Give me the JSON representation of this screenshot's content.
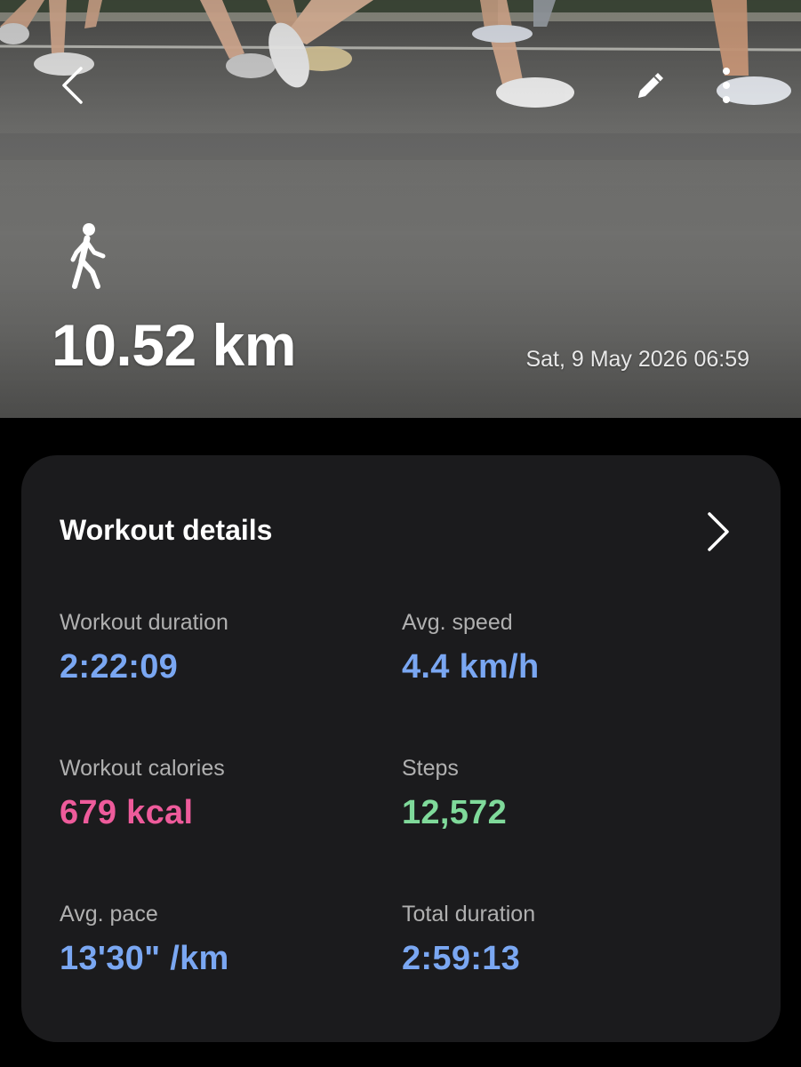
{
  "colors": {
    "blue": "#7aa7f2",
    "pink": "#ee5b9b",
    "green": "#7fd99a",
    "card_bg": "#1b1b1d",
    "label": "#b0b0b0"
  },
  "icons": {
    "back": "chevron-left-icon",
    "edit": "pencil-icon",
    "more": "more-vertical-icon",
    "activity": "walking-person-icon",
    "details": "chevron-right-icon"
  },
  "hero": {
    "distance": "10.52 km",
    "datetime": "Sat, 9 May 2026 06:59"
  },
  "card": {
    "title": "Workout details",
    "metrics": {
      "workout_duration": {
        "label": "Workout duration",
        "value": "2:22:09"
      },
      "avg_speed": {
        "label": "Avg. speed",
        "value": "4.4 km/h"
      },
      "workout_calories": {
        "label": "Workout calories",
        "value": "679 kcal"
      },
      "steps": {
        "label": "Steps",
        "value": "12,572"
      },
      "avg_pace": {
        "label": "Avg. pace",
        "value": "13'30\" /km"
      },
      "total_duration": {
        "label": "Total duration",
        "value": "2:59:13"
      }
    }
  }
}
